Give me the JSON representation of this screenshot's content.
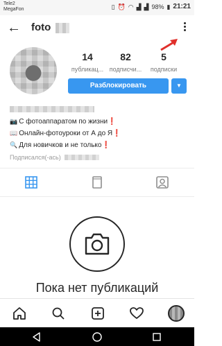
{
  "status_bar": {
    "carrier_line1": "Tele2",
    "carrier_line2": "MegaFon",
    "battery": "98%",
    "time": "21:21"
  },
  "header": {
    "username": "foto"
  },
  "profile": {
    "stats": [
      {
        "value": "14",
        "label": "публикац..."
      },
      {
        "value": "82",
        "label": "подписчи..."
      },
      {
        "value": "5",
        "label": "подписки"
      }
    ],
    "unblock_label": "Разблокировать"
  },
  "bio": {
    "lines": [
      {
        "emoji": "📷",
        "text": "С фотоаппаратом по жизни",
        "mark": "❗"
      },
      {
        "emoji": "📖",
        "text": "Онлайн-фотоуроки от А до Я",
        "mark": "❗"
      },
      {
        "emoji": "🔍",
        "text": "Для новичков и не только",
        "mark": "❗"
      }
    ],
    "signed": "Подписался(-ась)"
  },
  "empty_state": {
    "title": "Пока нет публикаций"
  },
  "colors": {
    "accent": "#3897f0",
    "text": "#262626",
    "muted": "#777777",
    "annotation_arrow": "#e0302b"
  }
}
